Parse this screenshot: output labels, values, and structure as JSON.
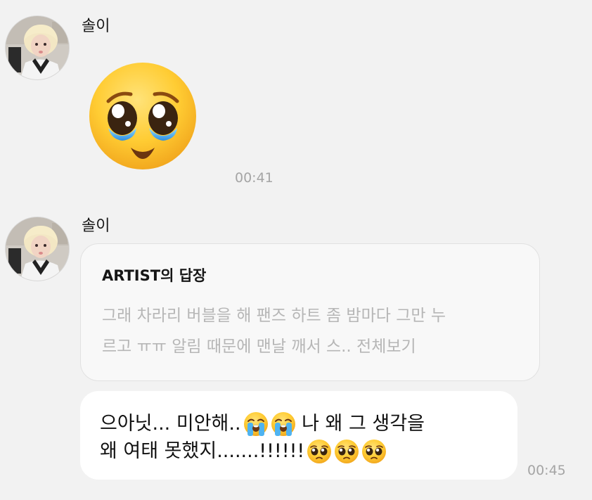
{
  "messages": [
    {
      "sender": "솔이",
      "avatar_icon": "profile-photo",
      "emoji_icon": "pleading-face-with-tears-emoji",
      "time": "00:41"
    },
    {
      "sender": "솔이",
      "avatar_icon": "profile-photo",
      "reply": {
        "header": "ARTIST의 답장",
        "preview_line1": "그래 차라리 버블을 해 팬즈 하트 좀 밤마다 그만 누",
        "preview_line2": "르고 ㅠㅠ 알림 때문에 맨날 깨서 스..",
        "more_label": "전체보기"
      },
      "text": {
        "line1_a": "으아닛... 미안해..",
        "line1_b": " 나 왜 그 생각을",
        "line2": "왜 여태 못했지.......!!!!!!",
        "crying_icon": "loudly-crying-face-emoji",
        "pleading_icon": "pleading-face-emoji"
      },
      "time": "00:45"
    }
  ],
  "colors": {
    "background": "#f2f2f2",
    "bubble": "#ffffff",
    "reply_card": "#f8f8f8",
    "reply_preview_text": "#b6b6b6",
    "timestamp": "#a5a5a5"
  }
}
